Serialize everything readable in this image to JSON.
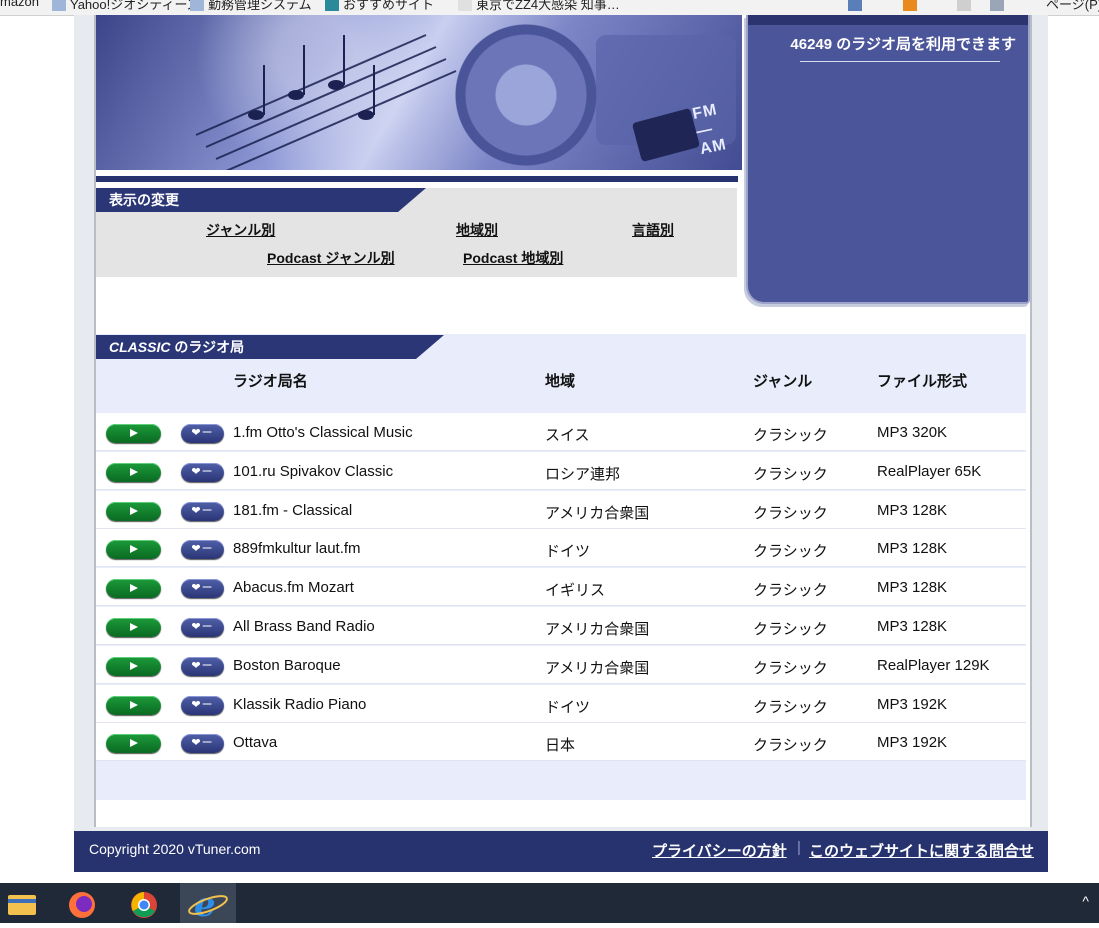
{
  "favorites_bar": {
    "items": [
      "mazon",
      "Yahoo!ジオシティーズ",
      "勤務管理システム",
      "おすすめサイト",
      "東京でZZ4大感染 知事…",
      "ページ(P)"
    ]
  },
  "header": {
    "station_count_text": "46249 のラジオ局を利用できます",
    "banner_label": "FM — AM"
  },
  "display_change": {
    "title": "表示の変更",
    "links": {
      "by_genre": "ジャンル別",
      "by_region": "地域別",
      "by_language": "言語別",
      "podcast_by_genre": "Podcast ジャンル別",
      "podcast_by_region": "Podcast 地域別"
    }
  },
  "stations": {
    "title_genre": "CLASSIC",
    "title_suffix": " のラジオ局",
    "columns": {
      "name": "ラジオ局名",
      "region": "地域",
      "genre": "ジャンル",
      "format": "ファイル形式"
    },
    "favorite_label": "❤ー",
    "rows": [
      {
        "name": "1.fm Otto's Classical Music",
        "region": "スイス",
        "genre": "クラシック",
        "format": "MP3 320K"
      },
      {
        "name": "101.ru Spivakov Classic",
        "region": "ロシア連邦",
        "genre": "クラシック",
        "format": "RealPlayer 65K"
      },
      {
        "name": "181.fm - Classical",
        "region": "アメリカ合衆国",
        "genre": "クラシック",
        "format": "MP3 128K"
      },
      {
        "name": "889fmkultur laut.fm",
        "region": "ドイツ",
        "genre": "クラシック",
        "format": "MP3 128K"
      },
      {
        "name": "Abacus.fm Mozart",
        "region": "イギリス",
        "genre": "クラシック",
        "format": "MP3 128K"
      },
      {
        "name": "All Brass Band Radio",
        "region": "アメリカ合衆国",
        "genre": "クラシック",
        "format": "MP3 128K"
      },
      {
        "name": "Boston Baroque",
        "region": "アメリカ合衆国",
        "genre": "クラシック",
        "format": "RealPlayer 129K"
      },
      {
        "name": "Klassik Radio Piano",
        "region": "ドイツ",
        "genre": "クラシック",
        "format": "MP3 192K"
      },
      {
        "name": "Ottava",
        "region": "日本",
        "genre": "クラシック",
        "format": "MP3 192K"
      }
    ]
  },
  "footer": {
    "copyright": "Copyright 2020 vTuner.com",
    "privacy_link": "プライバシーの方針",
    "separator": "|",
    "contact_link": "このウェブサイトに関する問合せ"
  },
  "taskbar": {
    "icons": [
      "file-explorer-icon",
      "firefox-icon",
      "chrome-icon",
      "internet-explorer-icon"
    ],
    "tray_chevron": "^"
  },
  "colors": {
    "navy": "#27336f",
    "panel": "#4b5599",
    "list_bg": "#e8ecfb",
    "play_green": "#0f7d2c"
  }
}
